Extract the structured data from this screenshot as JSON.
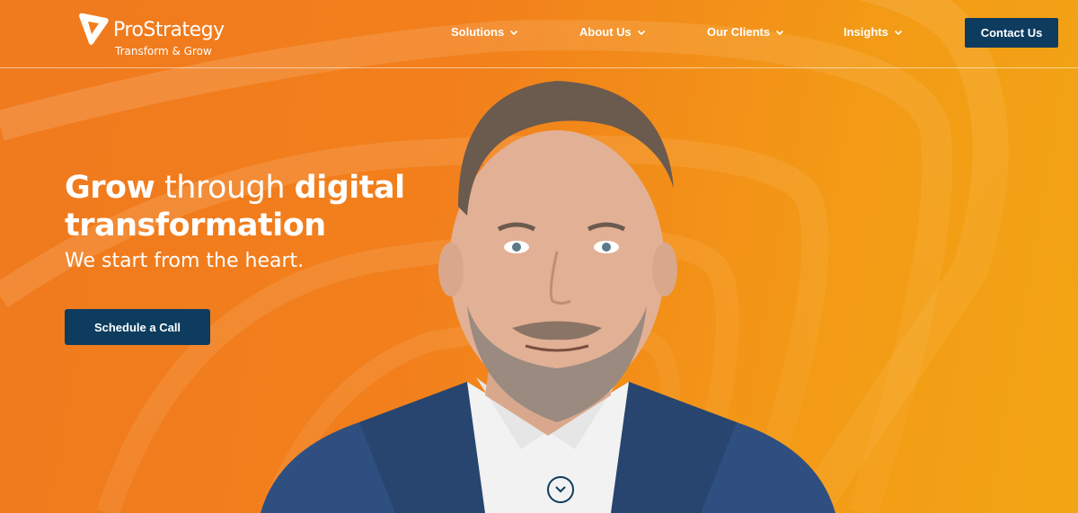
{
  "brand": {
    "name": "ProStrategy",
    "tagline": "Transform & Grow"
  },
  "nav": {
    "items": [
      {
        "label": "Solutions",
        "icon": "chevron-down-icon"
      },
      {
        "label": "About Us",
        "icon": "chevron-down-icon"
      },
      {
        "label": "Our Clients",
        "icon": "chevron-down-icon"
      },
      {
        "label": "Insights",
        "icon": "chevron-down-icon"
      }
    ],
    "contact_label": "Contact Us"
  },
  "hero": {
    "headline_part1": "Grow",
    "headline_part2": " through ",
    "headline_part3": "digital",
    "headline_part4": "transformation",
    "subhead": "We start from the heart.",
    "cta_label": "Schedule a Call"
  },
  "colors": {
    "accent_orange": "#f27f1c",
    "navy": "#0d3c5f",
    "white": "#ffffff"
  },
  "icons": {
    "scroll": "chevron-down-circle-icon",
    "logo": "triangle-logo-icon"
  }
}
